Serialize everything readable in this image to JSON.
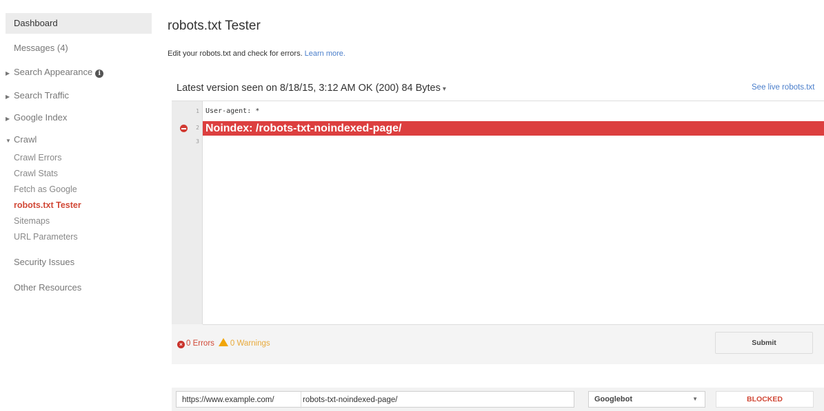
{
  "sidebar": {
    "dashboard": "Dashboard",
    "messages": "Messages (4)",
    "search_appearance": "Search Appearance",
    "search_traffic": "Search Traffic",
    "google_index": "Google Index",
    "crawl": "Crawl",
    "crawl_items": [
      "Crawl Errors",
      "Crawl Stats",
      "Fetch as Google",
      "robots.txt Tester",
      "Sitemaps",
      "URL Parameters"
    ],
    "security_issues": "Security Issues",
    "other_resources": "Other Resources"
  },
  "main": {
    "title": "robots.txt Tester",
    "subtitle": "Edit your robots.txt and check for errors.",
    "learn_more": "Learn more.",
    "version": "Latest version seen on 8/18/15, 3:12 AM OK (200) 84 Bytes",
    "see_live": "See live robots.txt"
  },
  "editor": {
    "lines": [
      {
        "num": "1",
        "text": "User-agent: *"
      },
      {
        "num": "2",
        "text": "Noindex: /robots-txt-noindexed-page/"
      },
      {
        "num": "3",
        "text": ""
      }
    ]
  },
  "status": {
    "errors": "0 Errors",
    "warnings": "0 Warnings",
    "submit": "Submit"
  },
  "tester": {
    "url_prefix": "https://www.example.com/",
    "url_path": "robots-txt-noindexed-page/",
    "bot": "Googlebot",
    "result": "BLOCKED"
  },
  "colors": {
    "error": "#dc3f3f",
    "link": "#4a7ecb",
    "active_nav": "#d14836",
    "warning": "#f1a60a"
  }
}
